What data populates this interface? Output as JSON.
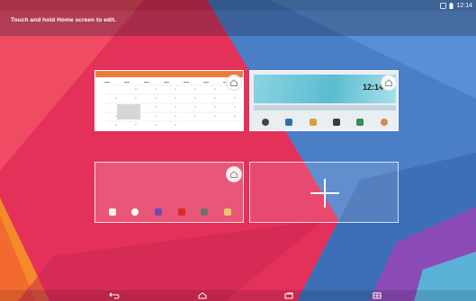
{
  "status_bar": {
    "time": "12:14",
    "icons": [
      "nfc-icon",
      "battery-icon"
    ]
  },
  "hint": {
    "text": "Touch and hold Home screen to edit."
  },
  "panels": [
    {
      "name": "calendar-widget-screen",
      "widget": "calendar",
      "home_icon": "home-icon"
    },
    {
      "name": "app-shortcuts-screen",
      "clock": "12:14",
      "home_icon": "home-icon"
    },
    {
      "name": "home-screen-preview",
      "home_icon": "home-icon"
    },
    {
      "name": "add-screen-panel",
      "action_icon": "plus-icon"
    }
  ],
  "navigation": {
    "buttons": [
      "back-icon",
      "home-icon",
      "recent-apps-icon",
      "menu-icon"
    ]
  },
  "colors": {
    "wallpaper_pink": "#e4315a",
    "wallpaper_blue": "#4a7fc8",
    "wallpaper_purple": "#8b4bb6",
    "calendar_header": "#f07a3c"
  }
}
